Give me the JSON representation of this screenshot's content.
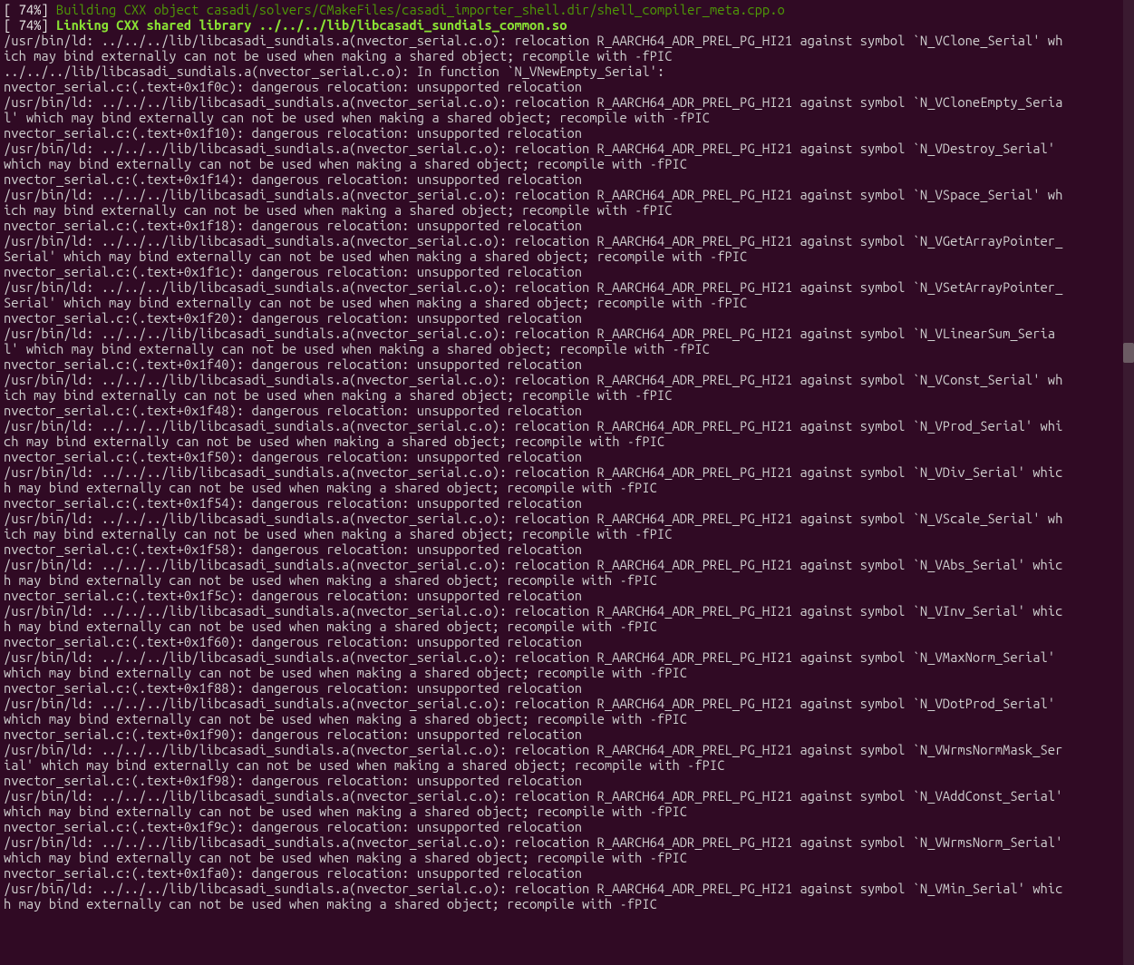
{
  "progress": {
    "p1_prefix": "[ 74%] ",
    "p1_msg": "Building CXX object casadi/solvers/CMakeFiles/casadi_importer_shell.dir/shell_compiler_meta.cpp.o",
    "p2_prefix": "[ 74%] ",
    "p2_msg": "Linking CXX shared library ../../../lib/libcasadi_sundials_common.so"
  },
  "lines": [
    "/usr/bin/ld: ../../../lib/libcasadi_sundials.a(nvector_serial.c.o): relocation R_AARCH64_ADR_PREL_PG_HI21 against symbol `N_VClone_Serial' which may bind externally can not be used when making a shared object; recompile with -fPIC",
    "../../../lib/libcasadi_sundials.a(nvector_serial.c.o): In function `N_VNewEmpty_Serial':",
    "nvector_serial.c:(.text+0x1f0c): dangerous relocation: unsupported relocation",
    "/usr/bin/ld: ../../../lib/libcasadi_sundials.a(nvector_serial.c.o): relocation R_AARCH64_ADR_PREL_PG_HI21 against symbol `N_VCloneEmpty_Serial' which may bind externally can not be used when making a shared object; recompile with -fPIC",
    "nvector_serial.c:(.text+0x1f10): dangerous relocation: unsupported relocation",
    "/usr/bin/ld: ../../../lib/libcasadi_sundials.a(nvector_serial.c.o): relocation R_AARCH64_ADR_PREL_PG_HI21 against symbol `N_VDestroy_Serial' which may bind externally can not be used when making a shared object; recompile with -fPIC",
    "nvector_serial.c:(.text+0x1f14): dangerous relocation: unsupported relocation",
    "/usr/bin/ld: ../../../lib/libcasadi_sundials.a(nvector_serial.c.o): relocation R_AARCH64_ADR_PREL_PG_HI21 against symbol `N_VSpace_Serial' which may bind externally can not be used when making a shared object; recompile with -fPIC",
    "nvector_serial.c:(.text+0x1f18): dangerous relocation: unsupported relocation",
    "/usr/bin/ld: ../../../lib/libcasadi_sundials.a(nvector_serial.c.o): relocation R_AARCH64_ADR_PREL_PG_HI21 against symbol `N_VGetArrayPointer_Serial' which may bind externally can not be used when making a shared object; recompile with -fPIC",
    "nvector_serial.c:(.text+0x1f1c): dangerous relocation: unsupported relocation",
    "/usr/bin/ld: ../../../lib/libcasadi_sundials.a(nvector_serial.c.o): relocation R_AARCH64_ADR_PREL_PG_HI21 against symbol `N_VSetArrayPointer_Serial' which may bind externally can not be used when making a shared object; recompile with -fPIC",
    "nvector_serial.c:(.text+0x1f20): dangerous relocation: unsupported relocation",
    "/usr/bin/ld: ../../../lib/libcasadi_sundials.a(nvector_serial.c.o): relocation R_AARCH64_ADR_PREL_PG_HI21 against symbol `N_VLinearSum_Serial' which may bind externally can not be used when making a shared object; recompile with -fPIC",
    "nvector_serial.c:(.text+0x1f40): dangerous relocation: unsupported relocation",
    "/usr/bin/ld: ../../../lib/libcasadi_sundials.a(nvector_serial.c.o): relocation R_AARCH64_ADR_PREL_PG_HI21 against symbol `N_VConst_Serial' which may bind externally can not be used when making a shared object; recompile with -fPIC",
    "nvector_serial.c:(.text+0x1f48): dangerous relocation: unsupported relocation",
    "/usr/bin/ld: ../../../lib/libcasadi_sundials.a(nvector_serial.c.o): relocation R_AARCH64_ADR_PREL_PG_HI21 against symbol `N_VProd_Serial' which may bind externally can not be used when making a shared object; recompile with -fPIC",
    "nvector_serial.c:(.text+0x1f50): dangerous relocation: unsupported relocation",
    "/usr/bin/ld: ../../../lib/libcasadi_sundials.a(nvector_serial.c.o): relocation R_AARCH64_ADR_PREL_PG_HI21 against symbol `N_VDiv_Serial' which may bind externally can not be used when making a shared object; recompile with -fPIC",
    "nvector_serial.c:(.text+0x1f54): dangerous relocation: unsupported relocation",
    "/usr/bin/ld: ../../../lib/libcasadi_sundials.a(nvector_serial.c.o): relocation R_AARCH64_ADR_PREL_PG_HI21 against symbol `N_VScale_Serial' which may bind externally can not be used when making a shared object; recompile with -fPIC",
    "nvector_serial.c:(.text+0x1f58): dangerous relocation: unsupported relocation",
    "/usr/bin/ld: ../../../lib/libcasadi_sundials.a(nvector_serial.c.o): relocation R_AARCH64_ADR_PREL_PG_HI21 against symbol `N_VAbs_Serial' which may bind externally can not be used when making a shared object; recompile with -fPIC",
    "nvector_serial.c:(.text+0x1f5c): dangerous relocation: unsupported relocation",
    "/usr/bin/ld: ../../../lib/libcasadi_sundials.a(nvector_serial.c.o): relocation R_AARCH64_ADR_PREL_PG_HI21 against symbol `N_VInv_Serial' which may bind externally can not be used when making a shared object; recompile with -fPIC",
    "nvector_serial.c:(.text+0x1f60): dangerous relocation: unsupported relocation",
    "/usr/bin/ld: ../../../lib/libcasadi_sundials.a(nvector_serial.c.o): relocation R_AARCH64_ADR_PREL_PG_HI21 against symbol `N_VMaxNorm_Serial' which may bind externally can not be used when making a shared object; recompile with -fPIC",
    "nvector_serial.c:(.text+0x1f88): dangerous relocation: unsupported relocation",
    "/usr/bin/ld: ../../../lib/libcasadi_sundials.a(nvector_serial.c.o): relocation R_AARCH64_ADR_PREL_PG_HI21 against symbol `N_VDotProd_Serial' which may bind externally can not be used when making a shared object; recompile with -fPIC",
    "nvector_serial.c:(.text+0x1f90): dangerous relocation: unsupported relocation",
    "/usr/bin/ld: ../../../lib/libcasadi_sundials.a(nvector_serial.c.o): relocation R_AARCH64_ADR_PREL_PG_HI21 against symbol `N_VWrmsNormMask_Serial' which may bind externally can not be used when making a shared object; recompile with -fPIC",
    "nvector_serial.c:(.text+0x1f98): dangerous relocation: unsupported relocation",
    "/usr/bin/ld: ../../../lib/libcasadi_sundials.a(nvector_serial.c.o): relocation R_AARCH64_ADR_PREL_PG_HI21 against symbol `N_VAddConst_Serial' which may bind externally can not be used when making a shared object; recompile with -fPIC",
    "nvector_serial.c:(.text+0x1f9c): dangerous relocation: unsupported relocation",
    "/usr/bin/ld: ../../../lib/libcasadi_sundials.a(nvector_serial.c.o): relocation R_AARCH64_ADR_PREL_PG_HI21 against symbol `N_VWrmsNorm_Serial' which may bind externally can not be used when making a shared object; recompile with -fPIC",
    "nvector_serial.c:(.text+0x1fa0): dangerous relocation: unsupported relocation",
    "/usr/bin/ld: ../../../lib/libcasadi_sundials.a(nvector_serial.c.o): relocation R_AARCH64_ADR_PREL_PG_HI21 against symbol `N_VMin_Serial' which may bind externally can not be used when making a shared object; recompile with -fPIC"
  ]
}
